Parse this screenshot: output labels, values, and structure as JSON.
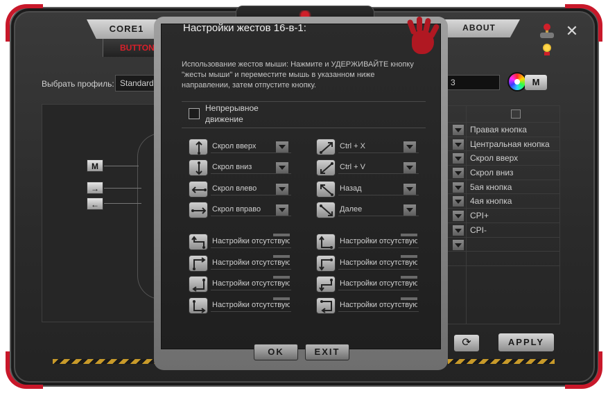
{
  "main": {
    "tabs": {
      "core": "CORE1",
      "buttons": "BUTTON",
      "about": "ABOUT"
    },
    "profile_label": "Выбрать профиль:",
    "profile_value": "Standard",
    "level_value": "3",
    "m_label": "M",
    "apply_label": "APPLY",
    "side_buttons": [
      "M",
      "→",
      "←"
    ],
    "assignments": [
      "Правая кнопка",
      "Центральная кнопка",
      "Скрол вверх",
      "Скрол вниз",
      "5ая кнопка",
      "4ая кнопка",
      "CPI+",
      "CPI-",
      "",
      ""
    ],
    "accent_red": "#c8182a",
    "stripe_color": "#c89a2a"
  },
  "dialog": {
    "title": "Настройки жестов 16-в-1:",
    "instructions": "Использование жестов мыши: Нажмите и УДЕРЖИВАЙТЕ кнопку \"жесты мыши\" и переместите мышь в указанном ниже направлении, затем отпустите кнопку.",
    "continuous_label": "Непрерывное движение",
    "left_gestures": [
      {
        "icon": "arrow-up-down-icon",
        "label": "Скрол вверх"
      },
      {
        "icon": "arrow-down-icon",
        "label": "Скрол вниз"
      },
      {
        "icon": "arrow-left-icon",
        "label": "Скрол влево"
      },
      {
        "icon": "arrow-right-icon",
        "label": "Скрол вправо"
      }
    ],
    "right_gestures": [
      {
        "icon": "arrow-up-right-icon",
        "label": "Ctrl + X"
      },
      {
        "icon": "arrow-down-left-icon",
        "label": "Ctrl + V"
      },
      {
        "icon": "arrow-up-left-icon",
        "label": "Назад"
      },
      {
        "icon": "arrow-down-right-icon",
        "label": "Далее"
      }
    ],
    "left_combo": [
      {
        "icon": "turn-up-left-icon",
        "label": "Настройки отсутствуют"
      },
      {
        "icon": "turn-right-up-icon",
        "label": "Настройки отсутствуют"
      },
      {
        "icon": "turn-left-down-icon",
        "label": "Настройки отсутствуют"
      },
      {
        "icon": "turn-down-right-icon",
        "label": "Настройки отсутствуют"
      }
    ],
    "right_combo": [
      {
        "icon": "turn-up-right-icon",
        "label": "Настройки отсутствуют"
      },
      {
        "icon": "turn-left-up-icon",
        "label": "Настройки отсутствуют"
      },
      {
        "icon": "turn-right-down-icon",
        "label": "Настройки отсутствуют"
      },
      {
        "icon": "turn-down-left-icon",
        "label": "Настройки отсутствуют"
      }
    ],
    "ok_label": "OK",
    "exit_label": "EXIT"
  }
}
